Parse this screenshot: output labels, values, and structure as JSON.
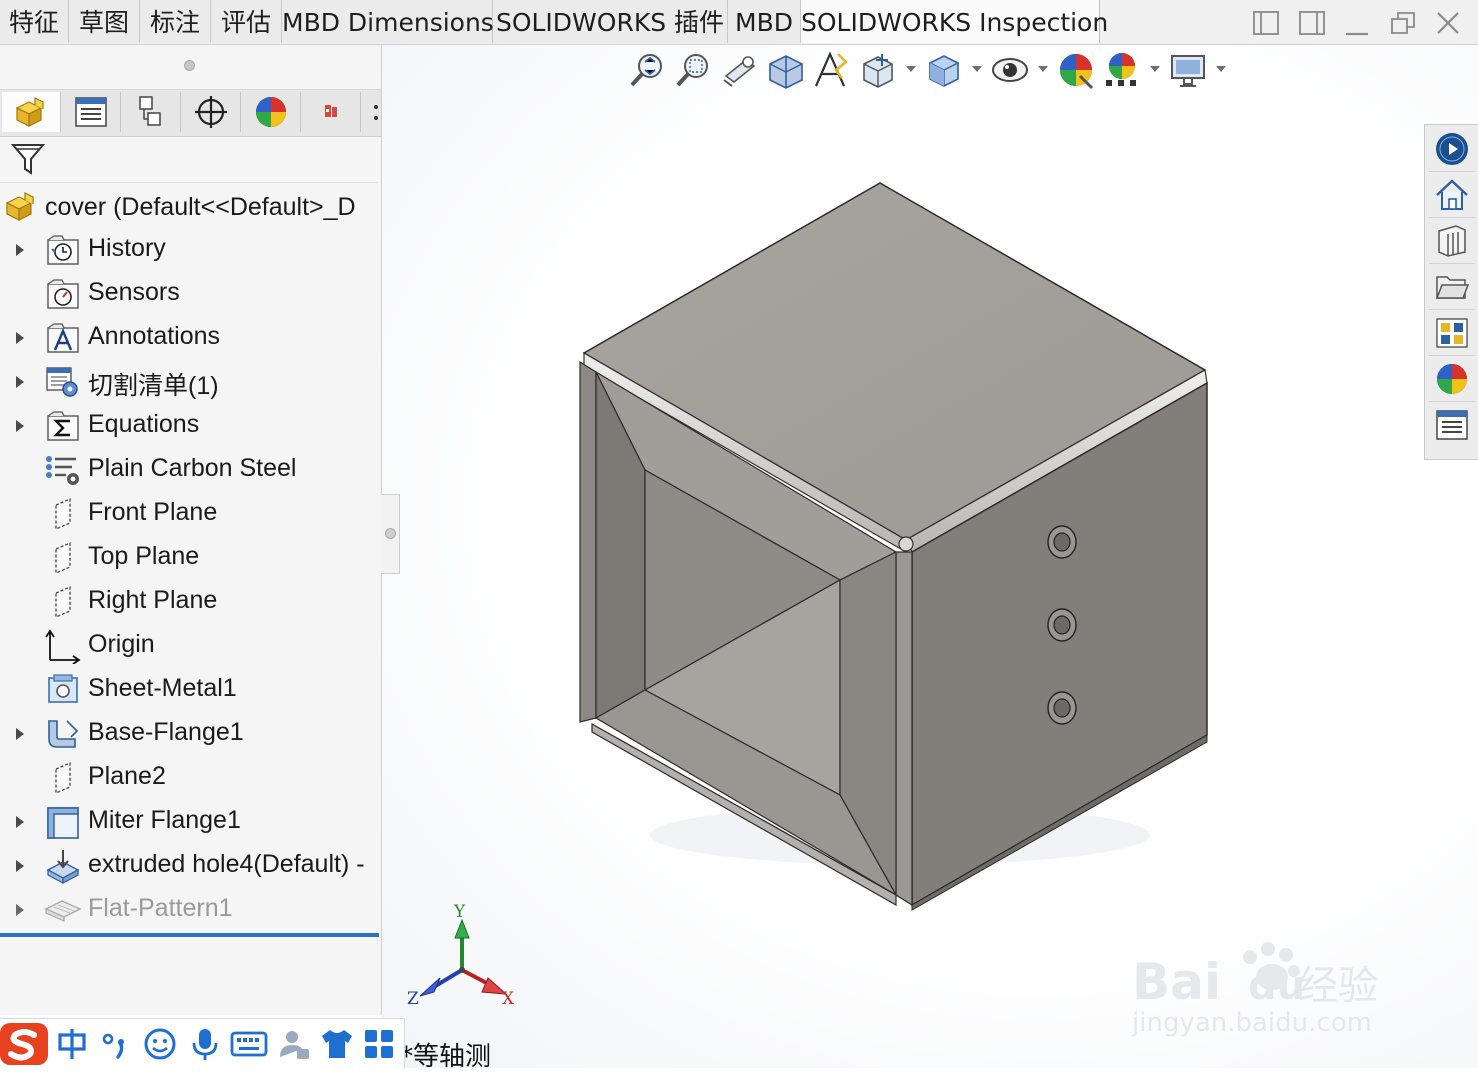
{
  "tabs": [
    {
      "label": "特征",
      "active": false
    },
    {
      "label": "草图",
      "active": false
    },
    {
      "label": "标注",
      "active": false
    },
    {
      "label": "评估",
      "active": false
    },
    {
      "label": "MBD Dimensions",
      "active": false
    },
    {
      "label": "SOLIDWORKS 插件",
      "active": false
    },
    {
      "label": "MBD",
      "active": false
    },
    {
      "label": "SOLIDWORKS Inspection",
      "active": true
    }
  ],
  "tree": {
    "root_label": "cover  (Default<<Default>_D",
    "items": [
      {
        "label": "History",
        "expandable": true,
        "icon": "history-icon"
      },
      {
        "label": "Sensors",
        "expandable": false,
        "icon": "sensors-icon"
      },
      {
        "label": "Annotations",
        "expandable": true,
        "icon": "annotations-icon"
      },
      {
        "label": "切割清单(1)",
        "expandable": true,
        "icon": "cut-list-icon"
      },
      {
        "label": "Equations",
        "expandable": true,
        "icon": "equations-icon"
      },
      {
        "label": "Plain Carbon Steel",
        "expandable": false,
        "icon": "material-icon"
      },
      {
        "label": "Front Plane",
        "expandable": false,
        "icon": "plane-icon"
      },
      {
        "label": "Top Plane",
        "expandable": false,
        "icon": "plane-icon"
      },
      {
        "label": "Right Plane",
        "expandable": false,
        "icon": "plane-icon"
      },
      {
        "label": "Origin",
        "expandable": false,
        "icon": "origin-icon"
      },
      {
        "label": "Sheet-Metal1",
        "expandable": false,
        "icon": "sheet-metal-icon"
      },
      {
        "label": "Base-Flange1",
        "expandable": true,
        "icon": "base-flange-icon"
      },
      {
        "label": "Plane2",
        "expandable": false,
        "icon": "plane-icon"
      },
      {
        "label": "Miter Flange1",
        "expandable": true,
        "icon": "miter-flange-icon"
      },
      {
        "label": "extruded hole4(Default) -",
        "expandable": true,
        "icon": "extruded-hole-icon"
      },
      {
        "label": "Flat-Pattern1",
        "expandable": true,
        "icon": "flat-pattern-icon",
        "suppressed": true
      }
    ]
  },
  "viewport": {
    "view_name": "*等轴测",
    "triad": {
      "x": "X",
      "y": "Y",
      "z": "Z"
    }
  },
  "watermark": {
    "brand": "Baidu经验",
    "url": "jingyan.baidu.com"
  },
  "colors": {
    "accent": "#2a73c4",
    "part_top": "#a3a09b",
    "part_side": "#827f7b"
  }
}
